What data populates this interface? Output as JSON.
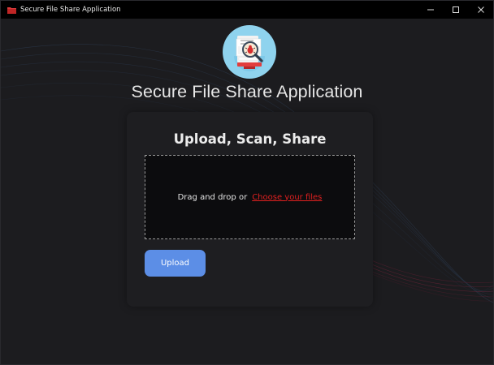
{
  "window": {
    "title": "Secure File Share Application",
    "icon": "app-folder-icon",
    "controls": [
      "minimize-icon",
      "maximize-icon",
      "close-icon"
    ]
  },
  "header": {
    "logo": "malware-scan-document-icon",
    "title": "Secure File Share Application"
  },
  "card": {
    "title": "Upload, Scan, Share",
    "dropzone": {
      "text": "Drag and drop or",
      "link": "Choose your files"
    },
    "upload_button": "Upload"
  },
  "colors": {
    "accent": "#5c8ee6",
    "link": "#e02020",
    "background": "#1c1c1f",
    "card": "#1e1e21"
  }
}
